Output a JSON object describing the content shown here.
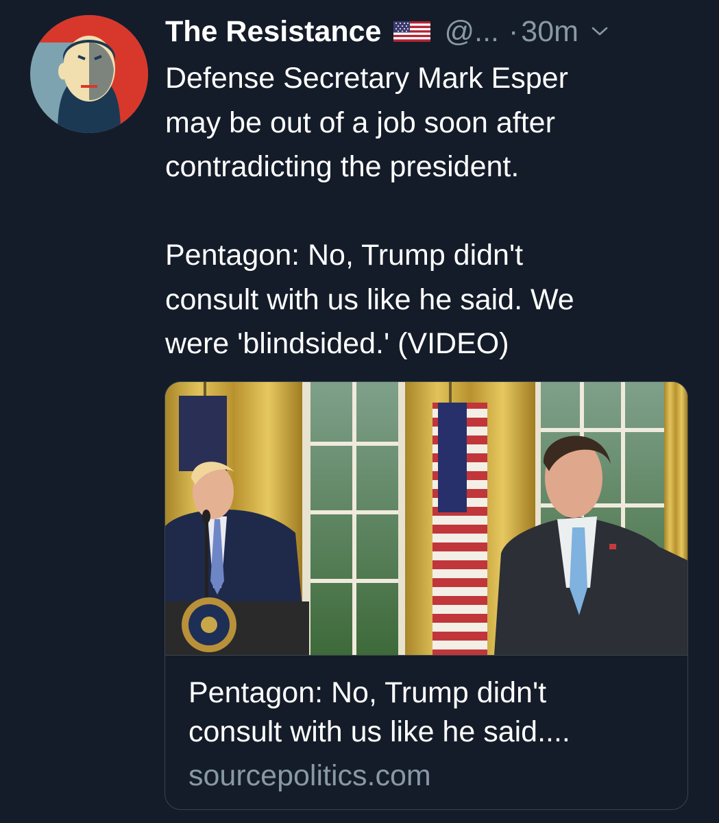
{
  "tweet": {
    "display_name": "The Resistance",
    "flag_icon": "us-flag-icon",
    "handle": "@...",
    "separator": "·",
    "timestamp": "30m",
    "menu_icon": "chevron-down-icon",
    "text_lines": [
      "Defense Secretary Mark Esper",
      "may be out of a job soon after",
      "contradicting the president."
    ],
    "text_lines_2": [
      "Pentagon: No, Trump didn't",
      "consult with us like he said. We",
      "were 'blindsided.' (VIDEO)"
    ]
  },
  "card": {
    "title_lines": [
      "Pentagon: No, Trump didn't",
      "consult with us like he said...."
    ],
    "domain": "sourcepolitics.com"
  },
  "colors": {
    "background": "#151c29",
    "text": "#ffffff",
    "secondary": "#8899a6",
    "border": "#38444d"
  }
}
